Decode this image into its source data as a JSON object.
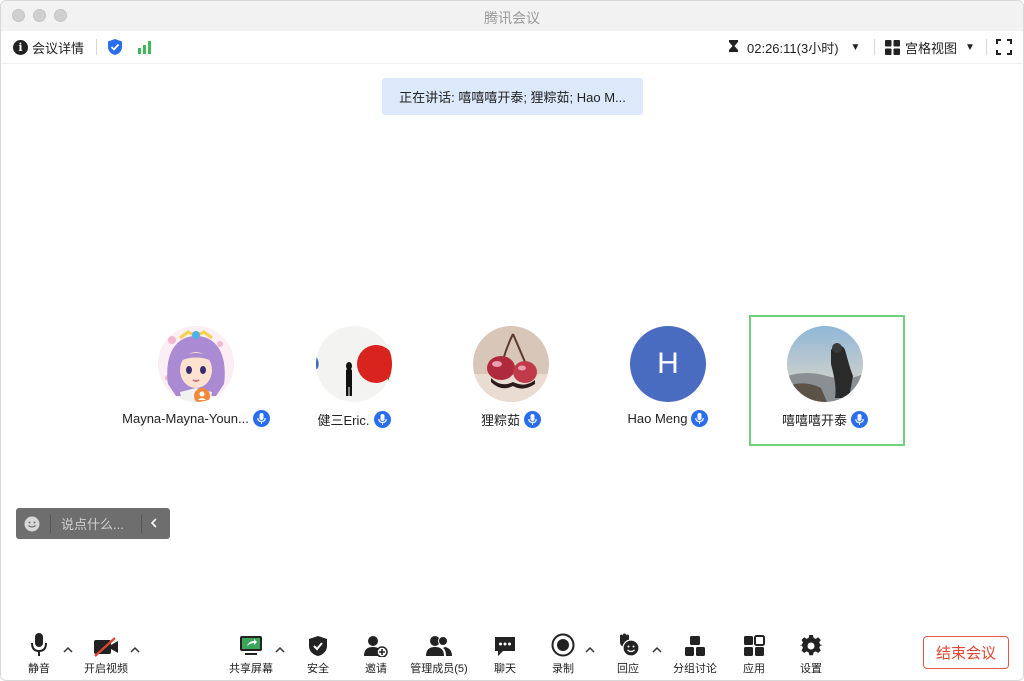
{
  "window": {
    "title": "腾讯会议"
  },
  "infobar": {
    "meeting_info_label": "会议详情",
    "duration": "02:26:11(3小时)",
    "view_label": "宫格视图"
  },
  "speaking": {
    "text": "正在讲话: 嘻嘻嘻开泰; 狸粽茹; Hao M..."
  },
  "participants": [
    {
      "name": "Mayna-Mayna-Youn...",
      "avatar": "anime-girl-avatar"
    },
    {
      "name": "健三Eric.",
      "avatar": "red-circle-photo-avatar"
    },
    {
      "name": "狸粽茹",
      "avatar": "cherries-photo-avatar"
    },
    {
      "name": "Hao Meng",
      "avatar_letter": "H",
      "avatar_color": "#4a6cc0"
    },
    {
      "name": "嘻嘻嘻开泰",
      "avatar": "mountain-photo-avatar"
    }
  ],
  "chat": {
    "placeholder": "说点什么..."
  },
  "toolbar": {
    "mute": "静音",
    "video": "开启视频",
    "share": "共享屏幕",
    "security": "安全",
    "invite": "邀请",
    "members": "管理成员(5)",
    "chat": "聊天",
    "record": "录制",
    "reactions": "回应",
    "breakout": "分组讨论",
    "apps": "应用",
    "settings": "设置",
    "end": "结束会议"
  },
  "colors": {
    "accent": "#2a6ef0",
    "active_border": "#6fd17c",
    "end": "#e2452f",
    "share_green": "#3ba55a"
  }
}
